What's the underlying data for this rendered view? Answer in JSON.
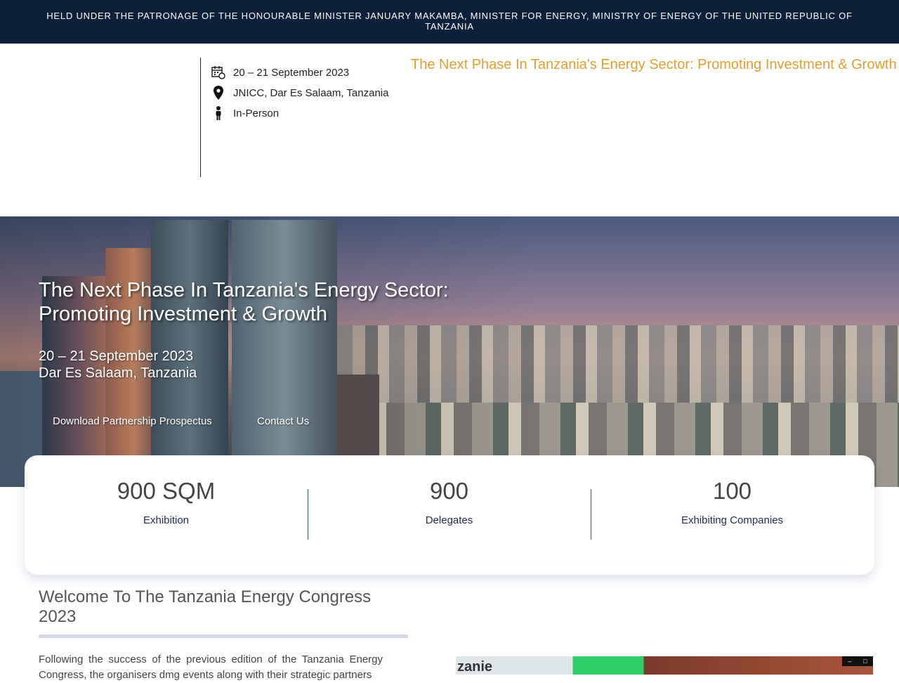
{
  "patronage": "HELD UNDER THE PATRONAGE OF THE HONOURABLE MINISTER JANUARY MAKAMBA, MINISTER FOR ENERGY, MINISTRY OF ENERGY OF THE UNITED REPUBLIC OF TANZANIA",
  "event_info": {
    "date": "20 – 21 September 2023",
    "venue": "JNICC, Dar Es Salaam, Tanzania",
    "format": "In-Person",
    "icons": [
      "calendar-icon",
      "location-pin-icon",
      "person-icon"
    ]
  },
  "tagline": "The Next Phase In Tanzania's Energy Sector: Promoting Investment & Growth",
  "hero": {
    "title": "The Next Phase In Tanzania's Energy Sector: Promoting Investment & Growth",
    "date": "20 – 21 September 2023",
    "location": "Dar Es Salaam, Tanzania",
    "buttons": {
      "prospectus": "Download Partnership Prospectus",
      "contact": "Contact Us"
    }
  },
  "stats": [
    {
      "value": "900 SQM",
      "label": "Exhibition"
    },
    {
      "value": "900",
      "label": "Delegates"
    },
    {
      "value": "100",
      "label": "Exhibiting Companies"
    }
  ],
  "welcome": {
    "title": "Welcome To The Tanzania Energy Congress 2023",
    "text": "Following the success of the previous edition of the Tanzania Energy Congress, the organisers dmg events along with their strategic partners"
  },
  "video": {
    "brand_text": "zanie",
    "controls": [
      "–",
      "□"
    ]
  },
  "colors": {
    "topbar_bg": "#0c1f3b",
    "tagline": "#e0a030",
    "stat_label": "#1e2b55"
  }
}
